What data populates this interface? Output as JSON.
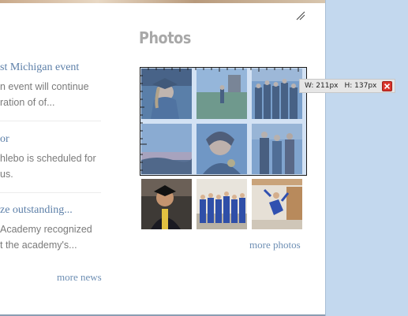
{
  "news": {
    "items": [
      {
        "title": "st Michigan event",
        "excerpt": [
          "n event will continue",
          "ration of of..."
        ]
      },
      {
        "title": "or",
        "excerpt": [
          "hlebo is scheduled for",
          "us."
        ]
      },
      {
        "title": "ze outstanding...",
        "excerpt": [
          "Academy recognized",
          "t the academy's..."
        ]
      }
    ],
    "more_link": "more news"
  },
  "photos": {
    "heading": "Photos",
    "thumbnails": [
      {
        "icon": "graduate-portrait-photo"
      },
      {
        "icon": "campus-lawn-photo"
      },
      {
        "icon": "group-graduates-photo"
      },
      {
        "icon": "dusk-sky-photo"
      },
      {
        "icon": "selfie-graduate-photo"
      },
      {
        "icon": "family-group-photo"
      },
      {
        "icon": "graduate-smiling-photo"
      },
      {
        "icon": "graduates-line-photo"
      },
      {
        "icon": "graduate-jumping-photo"
      }
    ],
    "more_link": "more photos"
  },
  "selection_tool": {
    "width_label": "W: 211px",
    "height_label": "H: 137px",
    "close_icon": "close-icon",
    "accent": "#d9342b"
  },
  "colors": {
    "link": "#5c7fa8",
    "side_panel": "#c3d8ee"
  }
}
